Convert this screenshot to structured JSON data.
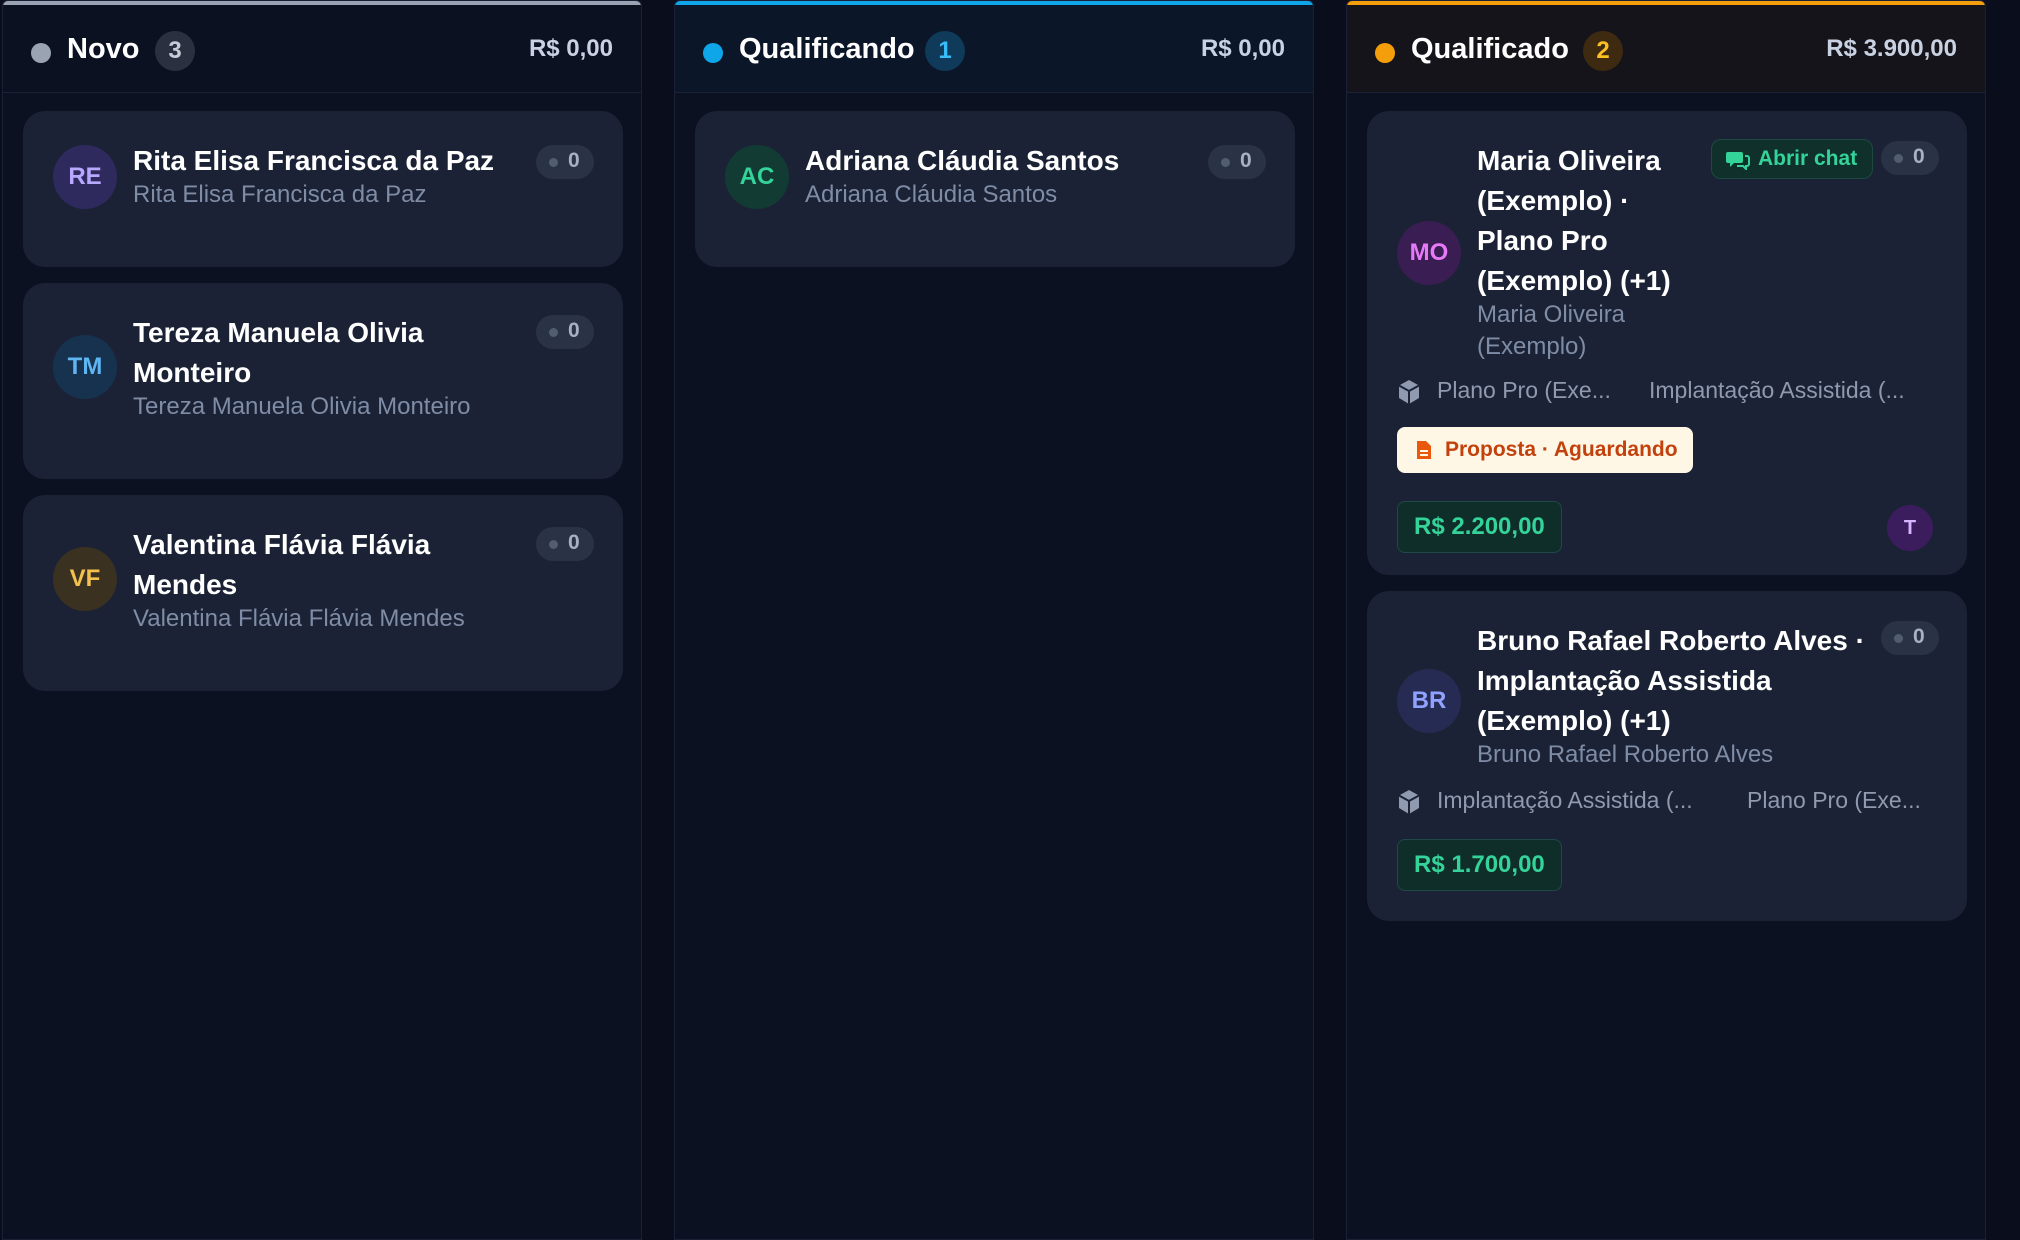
{
  "colors": {
    "novo": "#9aa3b2",
    "qualificando": "#0ea5e9",
    "qualificado": "#f59e0b"
  },
  "columns": [
    {
      "title": "Novo",
      "count": "3",
      "total": "R$ 0,00",
      "cards": [
        {
          "initials": "RE",
          "name": "Rita Elisa Francisca da Paz",
          "contact": "Rita Elisa Francisca da Paz",
          "messages": "0"
        },
        {
          "initials": "TM",
          "name_line1": "Tereza Manuela Olivia",
          "name_line2": "Monteiro",
          "contact": "Tereza Manuela Olivia Monteiro",
          "messages": "0"
        },
        {
          "initials": "VF",
          "name_line1": "Valentina Flávia Flávia",
          "name_line2": "Mendes",
          "contact": "Valentina Flávia Flávia Mendes",
          "messages": "0"
        }
      ]
    },
    {
      "title": "Qualificando",
      "count": "1",
      "total": "R$ 0,00",
      "cards": [
        {
          "initials": "AC",
          "name": "Adriana Cláudia Santos",
          "contact": "Adriana Cláudia Santos",
          "messages": "0"
        }
      ]
    },
    {
      "title": "Qualificado",
      "count": "2",
      "total": "R$ 3.900,00",
      "cards": [
        {
          "initials": "MO",
          "name_lines": [
            "Maria Oliveira",
            "(Exemplo) ·",
            "Plano Pro",
            "(Exemplo) (+1)"
          ],
          "contact_lines": [
            "Maria Oliveira",
            "(Exemplo)"
          ],
          "chat_label": "Abrir chat",
          "messages": "0",
          "products": [
            "Plano Pro (Exe...",
            "Implantação Assistida (..."
          ],
          "proposal": "Proposta · Aguardando",
          "value": "R$ 2.200,00",
          "owner_initial": "T"
        },
        {
          "initials": "BR",
          "name_lines": [
            "Bruno Rafael Roberto Alves ·",
            "Implantação Assistida",
            "(Exemplo) (+1)"
          ],
          "contact": "Bruno Rafael Roberto Alves",
          "messages": "0",
          "products": [
            "Implantação Assistida (...",
            "Plano Pro (Exe..."
          ],
          "value": "R$ 1.700,00"
        }
      ]
    }
  ],
  "icons": {
    "status_dot": "circle",
    "message_count": "dot",
    "chat": "chat-bubble-icon",
    "product": "cube-icon",
    "proposal": "document-icon"
  }
}
